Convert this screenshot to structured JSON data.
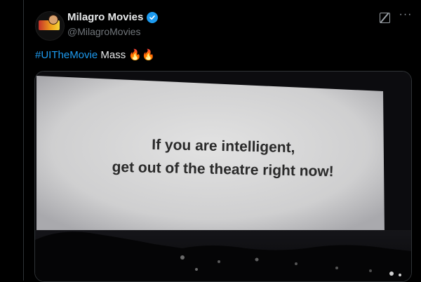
{
  "tweet": {
    "author": {
      "display_name": "Milagro Movies",
      "handle": "@MilagroMovies",
      "verified": true,
      "avatar_icon": "milagro-movies-logo"
    },
    "header_icons": [
      "grok-icon",
      "more-icon"
    ],
    "text": {
      "hashtag": "#UITheMovie",
      "body": " Mass ",
      "emoji": "🔥🔥"
    },
    "media": {
      "screen_line_1": "If you are intelligent,",
      "screen_line_2": "get out of the theatre right now!"
    }
  },
  "colors": {
    "background": "#000000",
    "accent": "#1d9bf0",
    "muted": "#71767b",
    "text": "#e7e9ea",
    "border": "#2f3336"
  }
}
